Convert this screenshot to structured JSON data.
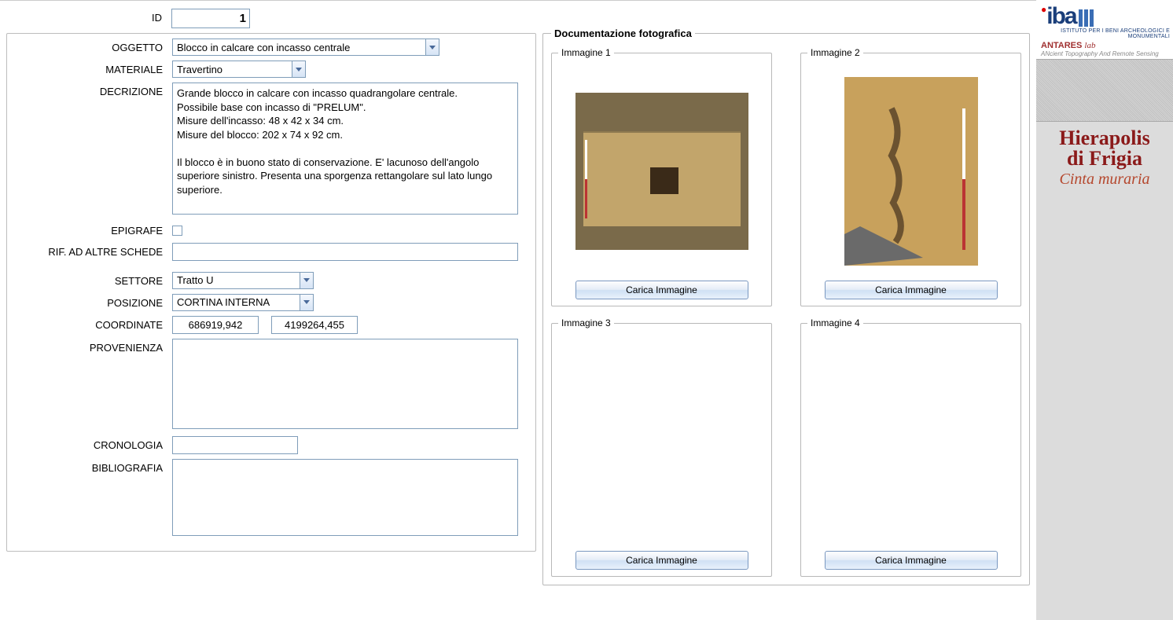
{
  "form": {
    "id_label": "ID",
    "id_value": "1",
    "oggetto_label": "OGGETTO",
    "oggetto_value": "Blocco in calcare con incasso centrale",
    "materiale_label": "MATERIALE",
    "materiale_value": "Travertino",
    "decrizione_label": "DECRIZIONE",
    "decrizione_value": "Grande blocco in calcare con incasso quadrangolare centrale.\nPossibile base con incasso di \"PRELUM\".\nMisure dell'incasso: 48 x 42 x 34 cm.\nMisure del blocco: 202 x 74 x 92 cm.\n\nIl blocco è in buono stato di conservazione. E' lacunoso dell'angolo superiore sinistro. Presenta una sporgenza rettangolare sul lato lungo superiore.",
    "epigrafe_label": "EPIGRAFE",
    "epigrafe_checked": false,
    "rif_label": "Rif. ad altre schede",
    "rif_value": "",
    "settore_label": "SETTORE",
    "settore_value": "Tratto U",
    "posizione_label": "POSIZIONE",
    "posizione_value": "CORTINA INTERNA",
    "coordinate_label": "COORDINATE",
    "coord_x": "686919,942",
    "coord_y": "4199264,455",
    "provenienza_label": "PROVENIENZA",
    "provenienza_value": "",
    "cronologia_label": "CRONOLOGIA",
    "cronologia_value": "",
    "bibliografia_label": "BIBLIOGRAFIA",
    "bibliografia_value": ""
  },
  "photo": {
    "section_title": "Documentazione fotografica",
    "slots": [
      {
        "legend": "Immagine 1",
        "button": "Carica Immagine",
        "has_image": true
      },
      {
        "legend": "Immagine 2",
        "button": "Carica Immagine",
        "has_image": true
      },
      {
        "legend": "Immagine 3",
        "button": "Carica Immagine",
        "has_image": false
      },
      {
        "legend": "Immagine 4",
        "button": "Carica Immagine",
        "has_image": false
      }
    ]
  },
  "sidebar": {
    "logo_text": "iba",
    "logo_subtext": "ISTITUTO PER I BENI ARCHEOLOGICI E MONUMENTALI",
    "antares_label": "ANTARES",
    "antares_script": "lab",
    "antares_sub": "ANcient Topography And Remote Sensing",
    "title1": "Hierapolis",
    "title2": "di Frigia",
    "subtitle": "Cinta muraria"
  }
}
